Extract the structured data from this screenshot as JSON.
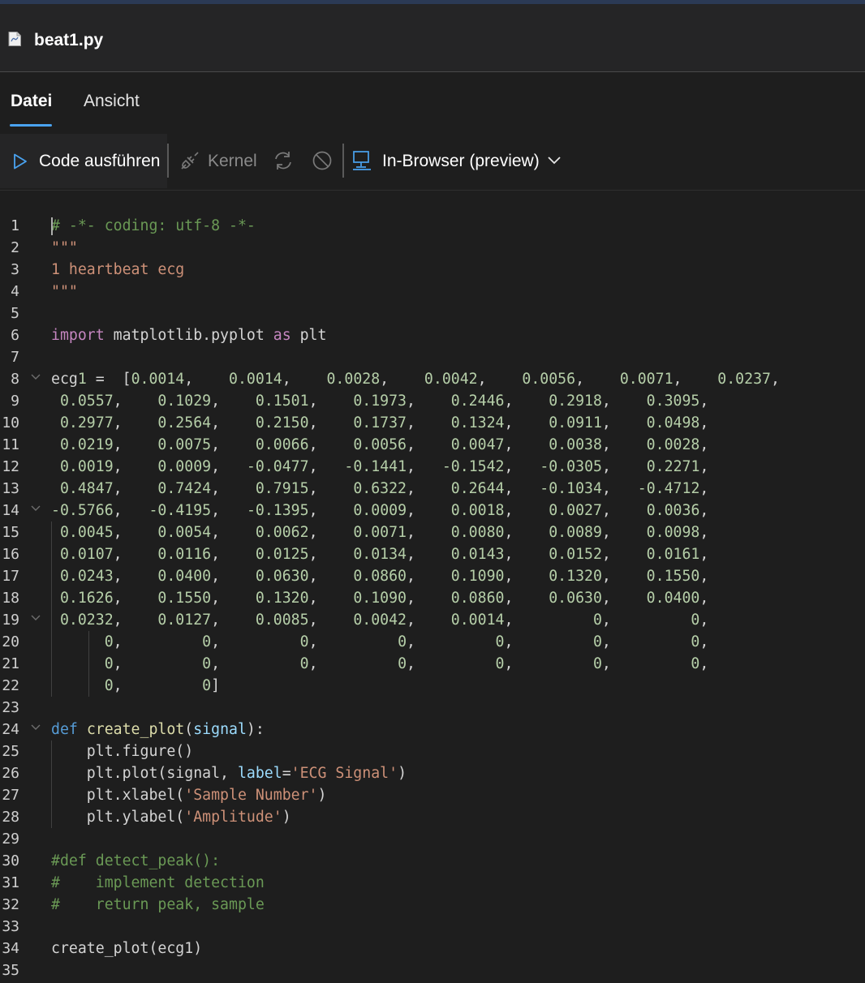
{
  "window": {
    "title": "beat1.py"
  },
  "tabs": [
    {
      "label": "Datei",
      "active": true
    },
    {
      "label": "Ansicht",
      "active": false
    }
  ],
  "toolbar": {
    "run_label": "Code ausführen",
    "kernel_label": "Kernel",
    "environment_label": "In-Browser (preview)"
  },
  "icons": {
    "file": "python-file-icon",
    "run": "play-icon",
    "kernel": "plug-icon",
    "restart": "restart-icon",
    "interrupt": "stop-icon",
    "environment": "monitor-icon",
    "dropdown": "chevron-down-icon"
  },
  "colors": {
    "accent": "#4aa3f0",
    "run_icon": "#4aa3f0",
    "comment": "#6a9955",
    "string": "#ce9178",
    "keyword": "#c586c0",
    "def_keyword": "#569cd6",
    "function": "#dcdcaa",
    "parameter": "#9cdcfe",
    "number": "#b5cea8"
  },
  "editor": {
    "lines": [
      {
        "n": "1",
        "text": "# -*- coding: utf-8 -*-",
        "style": "com"
      },
      {
        "n": "2",
        "text": "\"\"\"",
        "style": "str"
      },
      {
        "n": "3",
        "text": "1 heartbeat ecg",
        "style": "str"
      },
      {
        "n": "4",
        "text": "\"\"\"",
        "style": "str"
      },
      {
        "n": "5",
        "text": "",
        "style": "plain"
      },
      {
        "n": "6",
        "text": "import matplotlib.pyplot as plt",
        "style": "import"
      },
      {
        "n": "7",
        "text": "",
        "style": "plain"
      },
      {
        "n": "8",
        "text": "ecg1 =  [0.0014,    0.0014,    0.0028,    0.0042,    0.0056,    0.0071,    0.0237,",
        "style": "num",
        "fold": true
      },
      {
        "n": "9",
        "text": " 0.0557,    0.1029,    0.1501,    0.1973,    0.2446,    0.2918,    0.3095,",
        "style": "num"
      },
      {
        "n": "10",
        "text": " 0.2977,    0.2564,    0.2150,    0.1737,    0.1324,    0.0911,    0.0498,",
        "style": "num"
      },
      {
        "n": "11",
        "text": " 0.0219,    0.0075,    0.0066,    0.0056,    0.0047,    0.0038,    0.0028,",
        "style": "num"
      },
      {
        "n": "12",
        "text": " 0.0019,    0.0009,   -0.0477,   -0.1441,   -0.1542,   -0.0305,    0.2271,",
        "style": "num"
      },
      {
        "n": "13",
        "text": " 0.4847,    0.7424,    0.7915,    0.6322,    0.2644,   -0.1034,   -0.4712,",
        "style": "num"
      },
      {
        "n": "14",
        "text": "-0.5766,   -0.4195,   -0.1395,    0.0009,    0.0018,    0.0027,    0.0036,",
        "style": "num",
        "fold": true
      },
      {
        "n": "15",
        "text": " 0.0045,    0.0054,    0.0062,    0.0071,    0.0080,    0.0089,    0.0098,",
        "style": "num"
      },
      {
        "n": "16",
        "text": " 0.0107,    0.0116,    0.0125,    0.0134,    0.0143,    0.0152,    0.0161,",
        "style": "num"
      },
      {
        "n": "17",
        "text": " 0.0243,    0.0400,    0.0630,    0.0860,    0.1090,    0.1320,    0.1550,",
        "style": "num"
      },
      {
        "n": "18",
        "text": " 0.1626,    0.1550,    0.1320,    0.1090,    0.0860,    0.0630,    0.0400,",
        "style": "num"
      },
      {
        "n": "19",
        "text": " 0.0232,    0.0127,    0.0085,    0.0042,    0.0014,         0,         0,",
        "style": "num",
        "fold": true
      },
      {
        "n": "20",
        "text": "      0,         0,         0,         0,         0,         0,         0,",
        "style": "num"
      },
      {
        "n": "21",
        "text": "      0,         0,         0,         0,         0,         0,         0,",
        "style": "num"
      },
      {
        "n": "22",
        "text": "      0,         0]",
        "style": "num"
      },
      {
        "n": "23",
        "text": "",
        "style": "plain"
      },
      {
        "n": "24",
        "text": "def create_plot(signal):",
        "style": "def",
        "fold": true
      },
      {
        "n": "25",
        "text": "    plt.figure()",
        "style": "plain"
      },
      {
        "n": "26",
        "text": "    plt.plot(signal, label='ECG Signal')",
        "style": "call_label"
      },
      {
        "n": "27",
        "text": "    plt.xlabel('Sample Number')",
        "style": "call_str"
      },
      {
        "n": "28",
        "text": "    plt.ylabel('Amplitude')",
        "style": "call_str"
      },
      {
        "n": "29",
        "text": "",
        "style": "plain"
      },
      {
        "n": "30",
        "text": "#def detect_peak():",
        "style": "com"
      },
      {
        "n": "31",
        "text": "#    implement detection",
        "style": "com"
      },
      {
        "n": "32",
        "text": "#    return peak, sample",
        "style": "com"
      },
      {
        "n": "33",
        "text": "",
        "style": "plain"
      },
      {
        "n": "34",
        "text": "create_plot(ecg1)",
        "style": "plain"
      },
      {
        "n": "35",
        "text": "",
        "style": "plain"
      }
    ]
  }
}
